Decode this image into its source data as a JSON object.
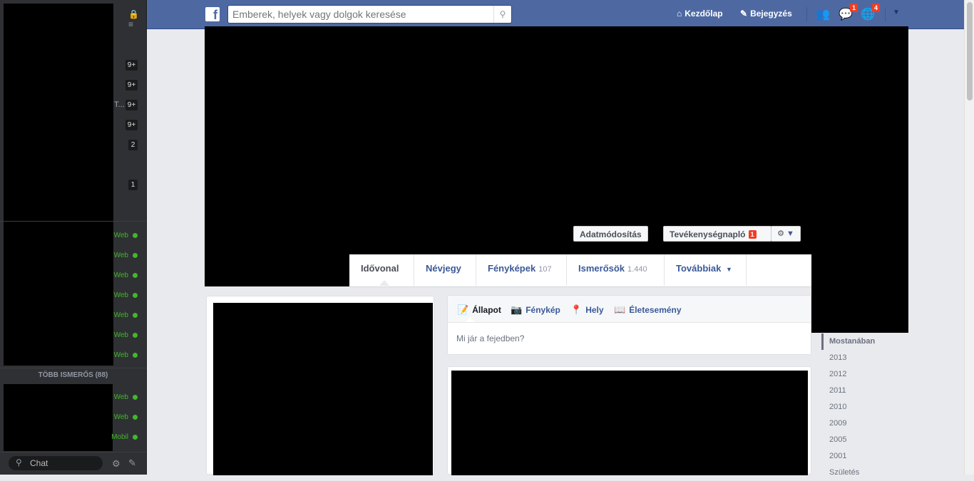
{
  "sidebar": {
    "counts": [
      "9+",
      "9+",
      "9+",
      "9+",
      "2",
      "1"
    ],
    "ellipsis": "T...",
    "presence": [
      "Web",
      "Web",
      "Web",
      "Web",
      "Web",
      "Web",
      "Web"
    ],
    "more_friends": "TÖBB ISMERŐS (88)",
    "presence_bottom": [
      "Web",
      "Web",
      "Mobil"
    ],
    "chat_label": "Chat"
  },
  "topbar": {
    "search_placeholder": "Emberek, helyek vagy dolgok keresése",
    "home_label": "Kezdőlap",
    "post_label": "Bejegyzés",
    "messages_badge": "1",
    "notifications_badge": "4"
  },
  "cover": {
    "edit_profile_label": "Adatmódosítás",
    "activity_log_label": "Tevékenységnapló",
    "activity_log_badge": "1"
  },
  "tabs": [
    {
      "label": "Idővonal",
      "count": ""
    },
    {
      "label": "Névjegy",
      "count": ""
    },
    {
      "label": "Fényképek",
      "count": "107"
    },
    {
      "label": "Ismerősök",
      "count": "1.440"
    },
    {
      "label": "Továbbiak",
      "count": ""
    }
  ],
  "composer": {
    "tabs": [
      "Állapot",
      "Fénykép",
      "Hely",
      "Életesemény"
    ],
    "placeholder": "Mi jár a fejedben?"
  },
  "timeline_years": [
    "Mostanában",
    "2013",
    "2012",
    "2011",
    "2010",
    "2009",
    "2005",
    "2001",
    "Születés"
  ]
}
